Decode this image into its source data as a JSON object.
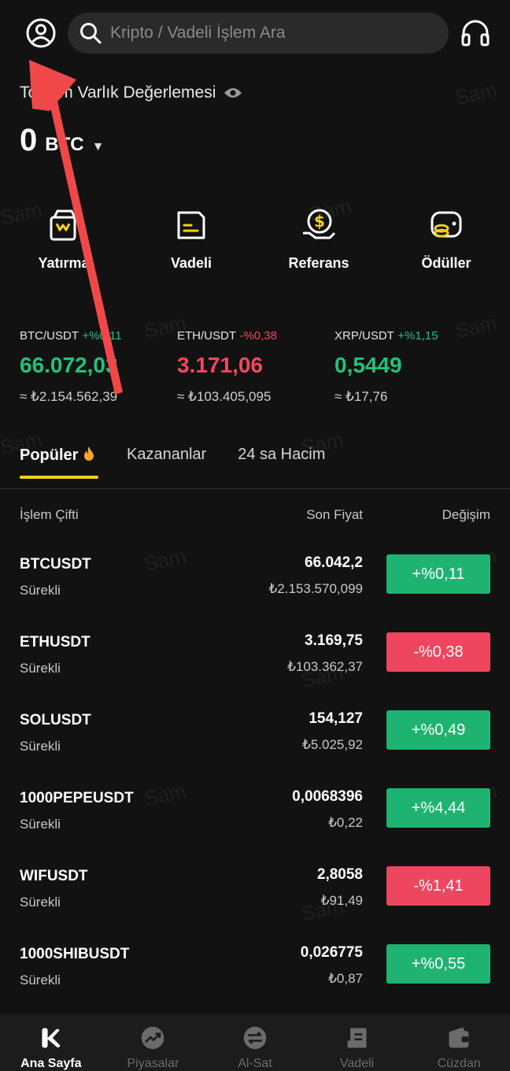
{
  "search": {
    "placeholder": "Kripto / Vadeli İşlem Ara"
  },
  "balance": {
    "label": "Toplam Varlık Değerlemesi",
    "value": "0",
    "unit": "BTC"
  },
  "quick_actions": [
    {
      "label": "Yatırma",
      "icon": "deposit-icon"
    },
    {
      "label": "Vadeli",
      "icon": "futures-icon"
    },
    {
      "label": "Referans",
      "icon": "referral-icon"
    },
    {
      "label": "Ödüller",
      "icon": "rewards-icon"
    }
  ],
  "tickers": [
    {
      "pair": "BTC/USDT",
      "change": "+%0,11",
      "price": "66.072,03",
      "fiat": "≈ ₺2.154.562,39",
      "direction": "up"
    },
    {
      "pair": "ETH/USDT",
      "change": "-%0,38",
      "price": "3.171,06",
      "fiat": "≈ ₺103.405,095",
      "direction": "down"
    },
    {
      "pair": "XRP/USDT",
      "change": "+%1,15",
      "price": "0,5449",
      "fiat": "≈ ₺17,76",
      "direction": "up"
    }
  ],
  "tabs": [
    {
      "label": "Popüler",
      "active": true
    },
    {
      "label": "Kazananlar",
      "active": false
    },
    {
      "label": "24 sa Hacim",
      "active": false
    }
  ],
  "table": {
    "headers": {
      "pair": "İşlem Çifti",
      "price": "Son Fiyat",
      "change": "Değişim"
    },
    "rows": [
      {
        "symbol": "BTCUSDT",
        "type": "Sürekli",
        "price": "66.042,2",
        "fiat": "₺2.153.570,099",
        "change": "+%0,11",
        "direction": "up"
      },
      {
        "symbol": "ETHUSDT",
        "type": "Sürekli",
        "price": "3.169,75",
        "fiat": "₺103.362,37",
        "change": "-%0,38",
        "direction": "down"
      },
      {
        "symbol": "SOLUSDT",
        "type": "Sürekli",
        "price": "154,127",
        "fiat": "₺5.025,92",
        "change": "+%0,49",
        "direction": "up"
      },
      {
        "symbol": "1000PEPEUSDT",
        "type": "Sürekli",
        "price": "0,0068396",
        "fiat": "₺0,22",
        "change": "+%4,44",
        "direction": "up"
      },
      {
        "symbol": "WIFUSDT",
        "type": "Sürekli",
        "price": "2,8058",
        "fiat": "₺91,49",
        "change": "-%1,41",
        "direction": "down"
      },
      {
        "symbol": "1000SHIBUSDT",
        "type": "Sürekli",
        "price": "0,026775",
        "fiat": "₺0,87",
        "change": "+%0,55",
        "direction": "up"
      }
    ]
  },
  "bottom_nav": [
    {
      "label": "Ana Sayfa",
      "icon": "home-icon",
      "active": true
    },
    {
      "label": "Piyasalar",
      "icon": "markets-icon",
      "active": false
    },
    {
      "label": "Al-Sat",
      "icon": "trade-icon",
      "active": false
    },
    {
      "label": "Vadeli",
      "icon": "futures-icon",
      "active": false
    },
    {
      "label": "Cüzdan",
      "icon": "wallet-icon",
      "active": false
    }
  ],
  "watermark": "Sam",
  "colors": {
    "up": "#1fb371",
    "down": "#ef4660",
    "accent": "#f2d21b",
    "annotation": "#f04848"
  }
}
